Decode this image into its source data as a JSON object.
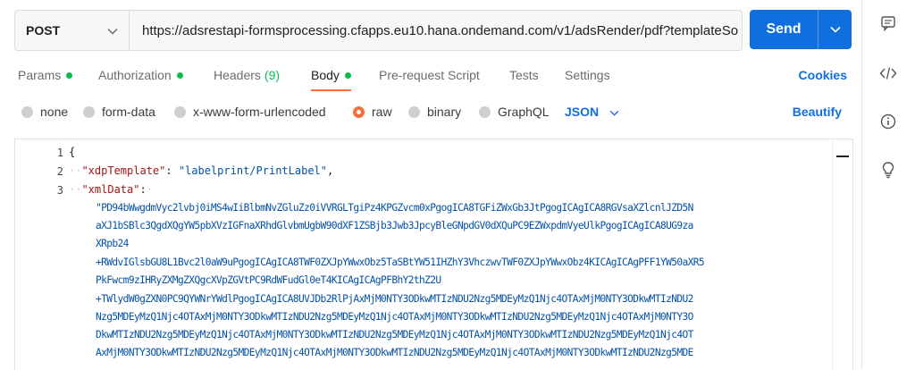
{
  "request": {
    "method": "POST",
    "url": "https://adsrestapi-formsprocessing.cfapps.eu10.hana.ondemand.com/v1/adsRender/pdf?templateSo",
    "send_label": "Send"
  },
  "tabs": {
    "params": "Params",
    "authorization": "Authorization",
    "headers": "Headers",
    "headers_count": "(9)",
    "body": "Body",
    "prerequest": "Pre-request Script",
    "tests": "Tests",
    "settings": "Settings",
    "cookies": "Cookies"
  },
  "body_options": {
    "none": "none",
    "form_data": "form-data",
    "urlencoded": "x-www-form-urlencoded",
    "raw": "raw",
    "binary": "binary",
    "graphql": "GraphQL",
    "language": "JSON",
    "beautify": "Beautify"
  },
  "editor": {
    "line_numbers": [
      "1",
      "2",
      "3"
    ],
    "line1": "{",
    "line2_key": "\"xdpTemplate\"",
    "line2_sep": ": ",
    "line2_value": "\"labelprint/PrintLabel\"",
    "line2_end": ",",
    "line3_key": "\"xmlData\"",
    "line3_sep": ":",
    "wrapped": [
      "\"PD94bWwgdmVyc2lvbj0iMS4wIiBlbmNvZGluZz0iVVRGLTgiPz4KPGZvcm0xPgogICA8TGFiZWxGb3JtPgogICAgICA8RGVsaXZlcnlJZD5N",
      "aXJ1bSBlc3QgdXQgYW5pbXVzIGFnaXRhdGlvbmUgbW90dXF1ZSBjb3Jwb3JpcyBleGNpdGV0dXQuPC9EZWxpdmVyeUlkPgogICAgICA8UG9za",
      "XRpb24",
      "+RWdvIGlsbGU8L1Bvc2l0aW9uPgogICAgICA8TWF0ZXJpYWwxObz5TaSBtYW51IHZhY3VhczwvTWF0ZXJpYWwxObz4KICAgICAgPFF1YW50aXR5",
      "PkFwcm9zIHRyZXMgZXQgcXVpZGVtPC9RdWFudGl0eT4KICAgICAgPFBhY2thZ2U",
      "+TWlydW0gZXN0PC9QYWNrYWdlPgogICAgICA8UVJDb2RlPjAxMjM0NTY3ODkwMTIzNDU2Nzg5MDEyMzQ1Njc4OTAxMjM0NTY3ODkwMTIzNDU2",
      "Nzg5MDEyMzQ1Njc4OTAxMjM0NTY3ODkwMTIzNDU2Nzg5MDEyMzQ1Njc4OTAxMjM0NTY3ODkwMTIzNDU2Nzg5MDEyMzQ1Njc4OTAxMjM0NTY3O",
      "DkwMTIzNDU2Nzg5MDEyMzQ1Njc4OTAxMjM0NTY3ODkwMTIzNDU2Nzg5MDEyMzQ1Njc4OTAxMjM0NTY3ODkwMTIzNDU2Nzg5MDEyMzQ1Njc4OT",
      "AxMjM0NTY3ODkwMTIzNDU2Nzg5MDEyMzQ1Njc4OTAxMjM0NTY3ODkwMTIzNDU2Nzg5MDEyMzQ1Njc4OTAxMjM0NTY3ODkwMTIzNDU2Nzg5MDE"
    ]
  },
  "colors": {
    "accent": "#ff6c37",
    "send": "#0f6fde",
    "status_dot": "#0cbb52"
  },
  "rightbar_icons": [
    "comment-icon",
    "code-icon",
    "info-icon",
    "lightbulb-icon"
  ]
}
